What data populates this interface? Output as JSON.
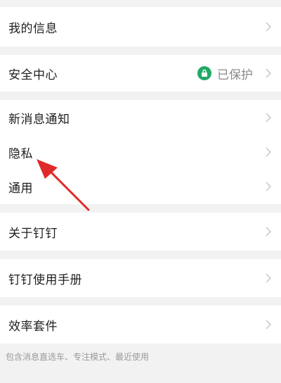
{
  "settings": {
    "my_info": "我的信息",
    "security_center": "安全中心",
    "security_status": "已保护",
    "new_message_notify": "新消息通知",
    "privacy": "隐私",
    "general": "通用",
    "about": "关于钉钉",
    "manual": "钉钉使用手册",
    "efficiency_suite": "效率套件",
    "efficiency_hint": "包含消息直选车、专注模式、最近使用"
  },
  "colors": {
    "shield_green": "#23a867",
    "arrow_red": "#e02a2a"
  }
}
